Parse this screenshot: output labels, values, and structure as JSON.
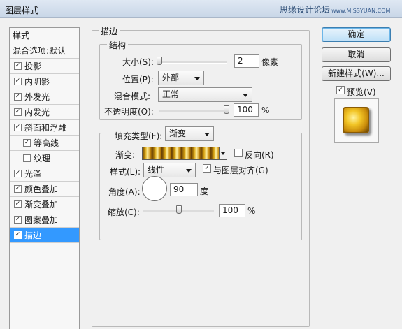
{
  "window": {
    "title": "图层样式",
    "watermark": "思缘设计论坛",
    "watermark_sub": "www.MISSYUAN.COM"
  },
  "sidebar": {
    "header": "样式",
    "items": [
      {
        "label": "混合选项:默认",
        "checkbox": false,
        "checked": false,
        "indent": false,
        "selected": false
      },
      {
        "label": "投影",
        "checkbox": true,
        "checked": true,
        "indent": false,
        "selected": false
      },
      {
        "label": "内阴影",
        "checkbox": true,
        "checked": true,
        "indent": false,
        "selected": false
      },
      {
        "label": "外发光",
        "checkbox": true,
        "checked": true,
        "indent": false,
        "selected": false
      },
      {
        "label": "内发光",
        "checkbox": true,
        "checked": true,
        "indent": false,
        "selected": false
      },
      {
        "label": "斜面和浮雕",
        "checkbox": true,
        "checked": true,
        "indent": false,
        "selected": false
      },
      {
        "label": "等高线",
        "checkbox": true,
        "checked": true,
        "indent": true,
        "selected": false
      },
      {
        "label": "纹理",
        "checkbox": true,
        "checked": false,
        "indent": true,
        "selected": false
      },
      {
        "label": "光泽",
        "checkbox": true,
        "checked": true,
        "indent": false,
        "selected": false
      },
      {
        "label": "颜色叠加",
        "checkbox": true,
        "checked": true,
        "indent": false,
        "selected": false
      },
      {
        "label": "渐变叠加",
        "checkbox": true,
        "checked": true,
        "indent": false,
        "selected": false
      },
      {
        "label": "图案叠加",
        "checkbox": true,
        "checked": true,
        "indent": false,
        "selected": false
      },
      {
        "label": "描边",
        "checkbox": true,
        "checked": true,
        "indent": false,
        "selected": true
      }
    ]
  },
  "stroke": {
    "group_title": "描边",
    "structure_title": "结构",
    "size_label": "大小(S):",
    "size_value": "2",
    "size_unit": "像素",
    "size_fraction": 0.0,
    "position_label": "位置(P):",
    "position_value": "外部",
    "blend_label": "混合模式:",
    "blend_value": "正常",
    "opacity_label": "不透明度(O):",
    "opacity_value": "100",
    "opacity_unit": "%",
    "opacity_fraction": 1.0
  },
  "fill": {
    "type_label": "填充类型(F):",
    "type_value": "渐变",
    "gradient_label": "渐变:",
    "reverse_label": "反向(R)",
    "reverse_checked": false,
    "style_label": "样式(L):",
    "style_value": "线性",
    "align_label": "与图层对齐(G)",
    "align_checked": true,
    "angle_label": "角度(A):",
    "angle_value": "90",
    "angle_unit": "度",
    "scale_label": "缩放(C):",
    "scale_value": "100",
    "scale_unit": "%",
    "scale_fraction": 0.5
  },
  "buttons": {
    "ok": "确定",
    "cancel": "取消",
    "new_style": "新建样式(W)...",
    "preview_label": "预览(V)",
    "preview_checked": true
  },
  "colors": {
    "selection": "#3399ff",
    "gold": "#d9a411"
  }
}
